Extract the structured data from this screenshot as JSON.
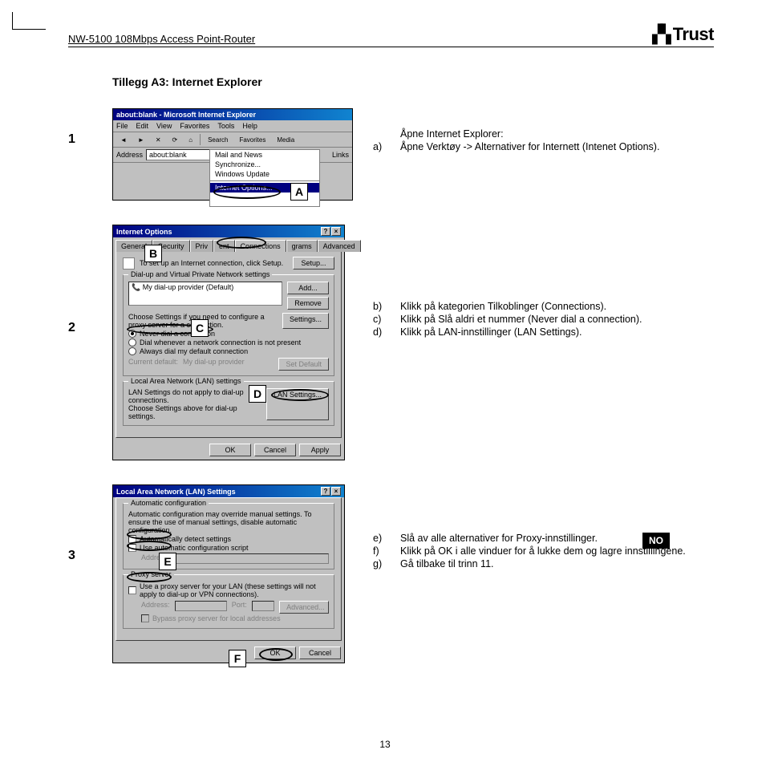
{
  "header": {
    "product": "NW-5100 108Mbps Access Point-Router",
    "brand": "Trust"
  },
  "section_title": "Tillegg A3: Internet Explorer",
  "steps": {
    "1": {
      "num": "1",
      "callout": "A",
      "shot1": {
        "title": "about:blank - Microsoft Internet Explorer",
        "menu": [
          "File",
          "Edit",
          "View",
          "Favorites",
          "Tools",
          "Help"
        ],
        "toolbar": [
          "Search",
          "Favorites",
          "Media"
        ],
        "addr_label": "Address",
        "addr_value": "about:blank",
        "links": "Links",
        "dropdown": [
          "Mail and News",
          "Synchronize...",
          "Windows Update",
          "Internet Options..."
        ]
      },
      "instr": [
        {
          "l": "a)",
          "t": "Åpne Verktøy -> Alternativer for Internett (Intenet Options)."
        }
      ],
      "intro": "Åpne Internet Explorer:"
    },
    "2": {
      "num": "2",
      "callouts": {
        "B": "B",
        "C": "C",
        "D": "D"
      },
      "shot2": {
        "title": "Internet Options",
        "tabs": [
          "General",
          "Security",
          "Privacy",
          "Content",
          "Connections",
          "Programs",
          "Advanced"
        ],
        "setup_line": "To set up an Internet connection, click Setup.",
        "setup_btn": "Setup...",
        "group_dial": "Dial-up and Virtual Private Network settings",
        "dial_item": "My dial-up provider (Default)",
        "add_btn": "Add...",
        "remove_btn": "Remove",
        "settings_btn": "Settings...",
        "proxy_note": "Choose Settings if you need to configure a proxy server for a connection.",
        "radio_never": "Never dial a connection",
        "radio_whenever": "Dial whenever a network connection is not present",
        "radio_always": "Always dial my default connection",
        "current_label": "Current default:",
        "current_value": "My dial-up provider",
        "setdefault_btn": "Set Default",
        "group_lan": "Local Area Network (LAN) settings",
        "lan_note1": "LAN Settings do not apply to dial-up connections.",
        "lan_note2": "Choose Settings above for dial-up settings.",
        "lan_btn": "LAN Settings...",
        "ok": "OK",
        "cancel": "Cancel",
        "apply": "Apply"
      },
      "instr": [
        {
          "l": "b)",
          "t": "Klikk på kategorien Tilkoblinger (Connections)."
        },
        {
          "l": "c)",
          "t": "Klikk på Slå aldri et nummer (Never dial a connection)."
        },
        {
          "l": "d)",
          "t": "Klikk på LAN-innstillinger (LAN Settings)."
        }
      ]
    },
    "3": {
      "num": "3",
      "callouts": {
        "E": "E",
        "F": "F"
      },
      "shot3": {
        "title": "Local Area Network (LAN) Settings",
        "group_auto": "Automatic configuration",
        "auto_note": "Automatic configuration may override manual settings. To ensure the use of manual settings, disable automatic configuration.",
        "auto_detect": "Automatically detect settings",
        "auto_script": "Use automatic configuration script",
        "addr_label": "Address",
        "group_proxy": "Proxy server",
        "proxy_check": "Use a proxy server for your LAN (these settings will not apply to dial-up or VPN connections).",
        "proxy_addr": "Address:",
        "proxy_port": "Port:",
        "advanced_btn": "Advanced...",
        "bypass": "Bypass proxy server for local addresses",
        "ok": "OK",
        "cancel": "Cancel"
      },
      "instr": [
        {
          "l": "e)",
          "t": "Slå av alle alternativer for Proxy-innstillinger."
        },
        {
          "l": "f)",
          "t": "Klikk på OK i alle vinduer for å lukke dem og lagre innstillingene."
        },
        {
          "l": "g)",
          "t": "Gå tilbake til trinn 11."
        }
      ]
    }
  },
  "no_badge": "NO",
  "page_number": "13"
}
